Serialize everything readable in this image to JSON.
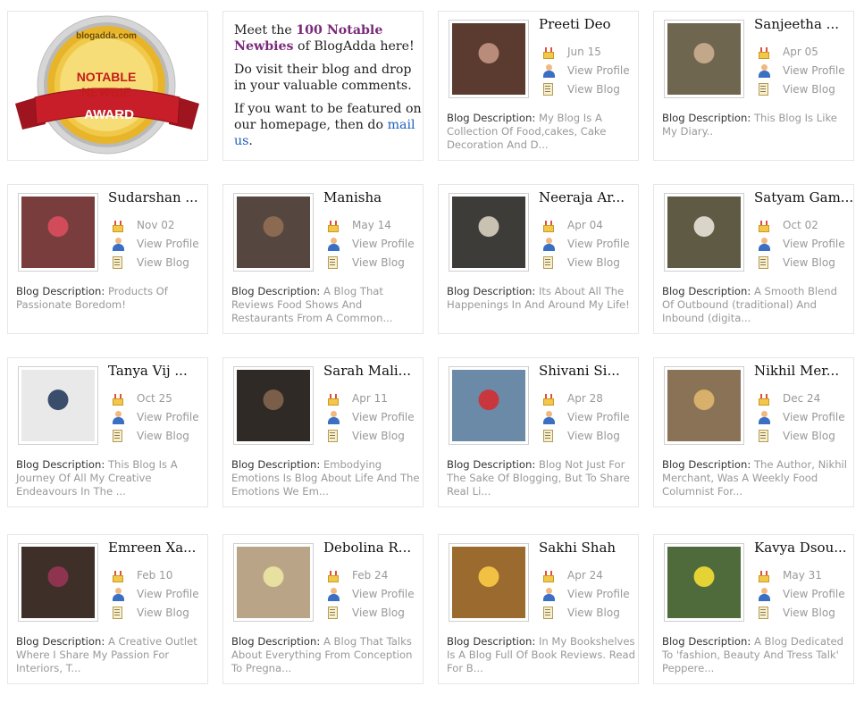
{
  "intro": {
    "p1_pre": "Meet the ",
    "p1_highlight": "100 Notable Newbies",
    "p1_post": " of BlogAdda here!",
    "p2": "Do visit their blog and drop in your valuable comments.",
    "p3_pre": "If you want to be featured on our homepage, then do ",
    "p3_link": "mail us",
    "p3_post": "."
  },
  "badge": {
    "top_text": "blogadda.com",
    "line1": "NOTABLE",
    "line2": "NEWBIE",
    "ribbon": "AWARD"
  },
  "labels": {
    "view_profile": "View Profile",
    "view_blog": "View Blog",
    "desc_label": "Blog Description: "
  },
  "bloggers": [
    {
      "name": "Preeti Deo",
      "date": "Jun 15",
      "desc": "My Blog Is A Collection Of Food,cakes, Cake Decoration And D...",
      "photo": "#5b3b2f",
      "accent": "#b98b7b"
    },
    {
      "name": "Sanjeetha ...",
      "date": "Apr 05",
      "desc": "This Blog Is Like My Diary..",
      "photo": "#6f6650",
      "accent": "#c2a78a"
    },
    {
      "name": "Sudarshan ...",
      "date": "Nov 02",
      "desc": "Products Of Passionate Boredom!",
      "photo": "#7a3d3d",
      "accent": "#d24b5a"
    },
    {
      "name": "Manisha",
      "date": "May 14",
      "desc": "A Blog That Reviews Food Shows And Restaurants From A Common...",
      "photo": "#55463f",
      "accent": "#8c6a52"
    },
    {
      "name": "Neeraja Ar...",
      "date": "Apr 04",
      "desc": "Its About All The Happenings In And Around My Life!",
      "photo": "#3e3c39",
      "accent": "#c9c2b2"
    },
    {
      "name": "Satyam Gam...",
      "date": "Oct 02",
      "desc": "A Smooth Blend Of Outbound (traditional) And Inbound (digita...",
      "photo": "#5e5a44",
      "accent": "#d9d5c8"
    },
    {
      "name": "Tanya Vij ...",
      "date": "Oct 25",
      "desc": "This Blog Is A Journey Of All My Creative Endeavours In The ...",
      "photo": "#e9e9ea",
      "accent": "#3a4d6a"
    },
    {
      "name": "Sarah Mali...",
      "date": "Apr 11",
      "desc": "Embodying Emotions Is Blog About Life And The Emotions We Em...",
      "photo": "#2f2a26",
      "accent": "#7b5e49"
    },
    {
      "name": "Shivani Si...",
      "date": "Apr 28",
      "desc": "Blog Not Just For The Sake Of Blogging, But To Share Real Li...",
      "photo": "#6a8aa8",
      "accent": "#c8373d"
    },
    {
      "name": "Nikhil Mer...",
      "date": "Dec 24",
      "desc": "The Author, Nikhil Merchant, Was A Weekly Food Columnist For...",
      "photo": "#8a7257",
      "accent": "#d7b06b"
    },
    {
      "name": "Emreen Xa...",
      "date": "Feb 10",
      "desc": "A Creative Outlet Where I Share My Passion For Interiors, T...",
      "photo": "#3e2f29",
      "accent": "#8f3450"
    },
    {
      "name": "Debolina R...",
      "date": "Feb 24",
      "desc": "A Blog That Talks About Everything From Conception To Pregna...",
      "photo": "#b9a487",
      "accent": "#e7e0a0"
    },
    {
      "name": "Sakhi Shah",
      "date": "Apr 24",
      "desc": "In My Bookshelves Is A Blog Full Of Book Reviews. Read For B...",
      "photo": "#9a6a2e",
      "accent": "#f2c043"
    },
    {
      "name": "Kavya Dsou...",
      "date": "May 31",
      "desc": "A Blog Dedicated To 'fashion, Beauty And Tress Talk' Peppere...",
      "photo": "#4f6a3b",
      "accent": "#e5d235"
    }
  ],
  "colors": {
    "highlight_purple": "#7a2a7a",
    "link_blue": "#1f5fbf",
    "meta_gray": "#999999",
    "card_border": "#e6e6e6",
    "badge_gold": "#e0b626",
    "badge_red": "#c81e2a"
  },
  "icons": {
    "date": "cake-icon",
    "profile": "user-icon",
    "blog": "blog-page-icon"
  }
}
